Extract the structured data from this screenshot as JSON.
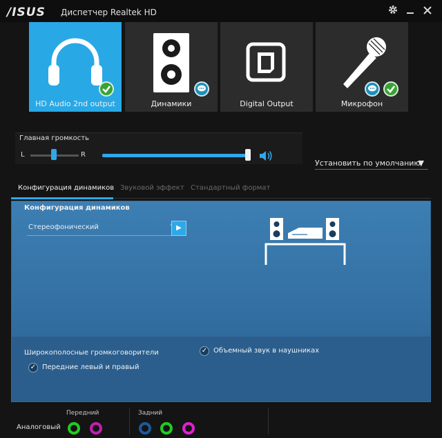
{
  "titlebar": {
    "logo": "/ISUS",
    "title": "Диспетчер Realtek HD",
    "settings_icon": "gear-icon",
    "minimize_icon": "minimize-icon",
    "close_icon": "close-icon"
  },
  "devices": [
    {
      "label": "HD Audio 2nd output",
      "icon": "headphones-icon",
      "active": true,
      "badges": [
        "check"
      ]
    },
    {
      "label": "Динамики",
      "icon": "speaker-icon",
      "active": false,
      "badges": [
        "chat"
      ]
    },
    {
      "label": "Digital Output",
      "icon": "digital-output-icon",
      "active": false,
      "badges": []
    },
    {
      "label": "Микрофон",
      "icon": "microphone-icon",
      "active": false,
      "badges": [
        "chat",
        "check"
      ]
    }
  ],
  "volume": {
    "title": "Главная громкость",
    "left": "L",
    "right": "R",
    "balance": 0.5,
    "level": 1.0
  },
  "default_dropdown": "Установить по умолчанию",
  "tabs": [
    "Конфигурация динамиков",
    "Звуковой эффект",
    "Стандартный формат"
  ],
  "panel": {
    "title": "Конфигурация динамиков",
    "select_value": "Стереофонический",
    "fullrange_label": "Широкополосные громкоговорители",
    "front_lr": "Передние левый и правый",
    "headphone_virtualization": "Объемный звук в наушниках"
  },
  "jacks": {
    "analog_label": "Аналоговый",
    "front_label": "Передний",
    "rear_label": "Задний",
    "front_colors": [
      "#22cc22",
      "#c21fb0"
    ],
    "rear_colors": [
      "#1a5a9a",
      "#22cc22",
      "#e020d0"
    ]
  },
  "colors": {
    "accent": "#2fa8e8",
    "panel_blue": "#336fa2"
  }
}
